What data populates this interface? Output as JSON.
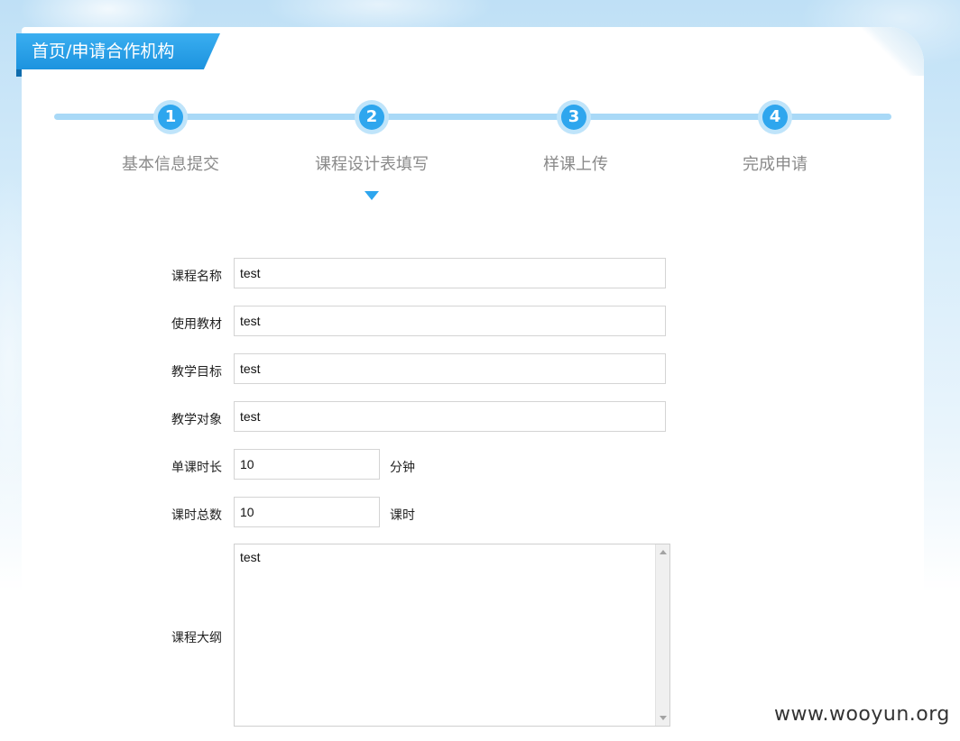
{
  "breadcrumb": "首页/申请合作机构",
  "steps": [
    {
      "number": "1",
      "label": "基本信息提交"
    },
    {
      "number": "2",
      "label": "课程设计表填写"
    },
    {
      "number": "3",
      "label": "样课上传"
    },
    {
      "number": "4",
      "label": "完成申请"
    }
  ],
  "form": {
    "course_name": {
      "label": "课程名称",
      "value": "test"
    },
    "textbook": {
      "label": "使用教材",
      "value": "test"
    },
    "teaching_goal": {
      "label": "教学目标",
      "value": "test"
    },
    "teaching_audience": {
      "label": "教学对象",
      "value": "test"
    },
    "lesson_duration": {
      "label": "单课时长",
      "value": "10",
      "unit": "分钟"
    },
    "total_lessons": {
      "label": "课时总数",
      "value": "10",
      "unit": "课时"
    },
    "outline": {
      "label": "课程大纲",
      "value": "test"
    }
  },
  "watermark": "www.wooyun.org",
  "colors": {
    "accent": "#2ea6ee",
    "track": "#a9d9f7"
  },
  "current_step": 2
}
